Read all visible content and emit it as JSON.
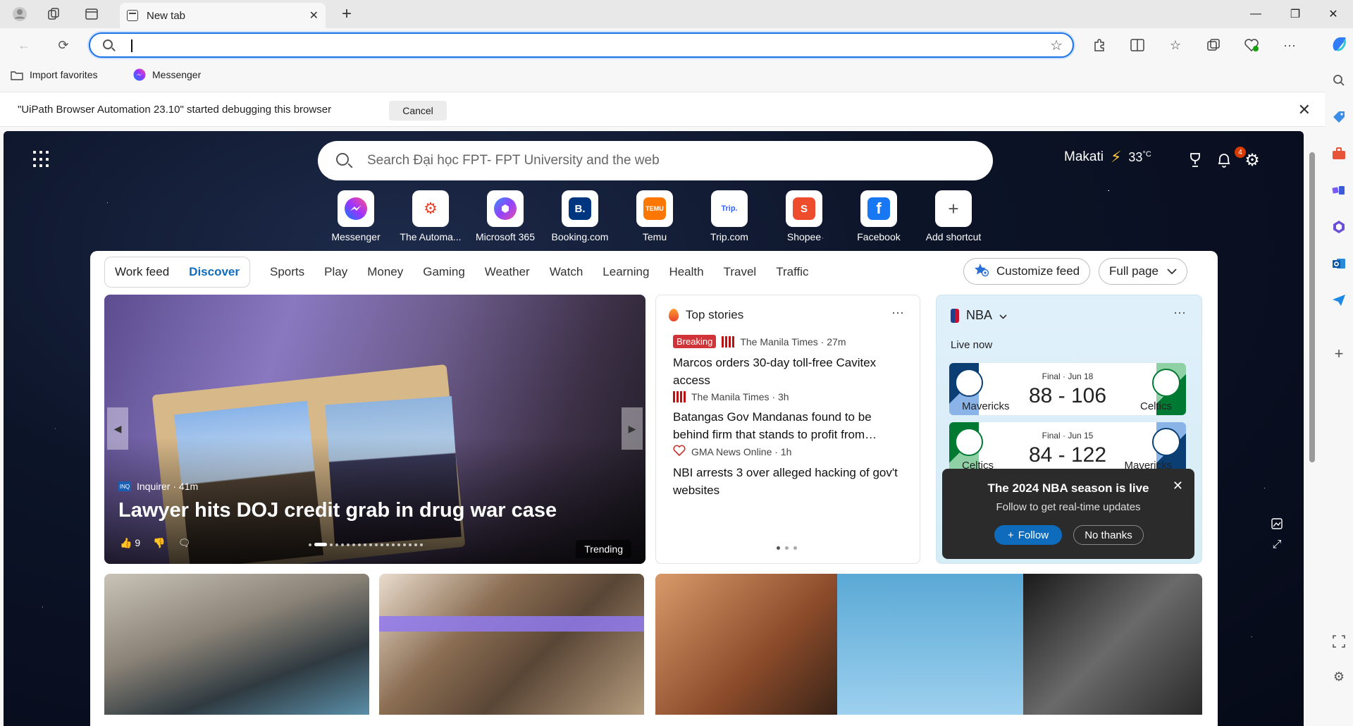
{
  "browser": {
    "tab_title": "New tab",
    "address_value": "",
    "favorites": [
      "Import favorites",
      "Messenger"
    ],
    "infobar_message": "\"UiPath Browser Automation 23.10\" started debugging this browser",
    "infobar_cancel": "Cancel"
  },
  "ntp": {
    "search_placeholder": "Search Đại học FPT- FPT University and the web",
    "city": "Makati",
    "temperature": "33",
    "temp_unit": "°C",
    "notifications": "4"
  },
  "shortcuts": [
    {
      "label": "Messenger",
      "icon": "messenger-icon",
      "color": "#8f44ff"
    },
    {
      "label": "The Automa...",
      "icon": "automation-icon",
      "color": "#e8432c"
    },
    {
      "label": "Microsoft 365",
      "icon": "m365-icon",
      "color": "#6a5acd"
    },
    {
      "label": "Booking.com",
      "icon": "booking-icon",
      "color": "#003580"
    },
    {
      "label": "Temu",
      "icon": "temu-icon",
      "color": "#fb7701"
    },
    {
      "label": "Trip.com",
      "icon": "trip-icon",
      "color": "#3264ff"
    },
    {
      "label": "Shopee",
      "icon": "shopee-icon",
      "color": "#ee4d2d"
    },
    {
      "label": "Facebook",
      "icon": "facebook-icon",
      "color": "#1877f2"
    },
    {
      "label": "Add shortcut",
      "icon": "plus-icon",
      "color": "#ffffff"
    }
  ],
  "feed": {
    "segments": [
      "Work feed",
      "Discover"
    ],
    "categories": [
      "Sports",
      "Play",
      "Money",
      "Gaming",
      "Weather",
      "Watch",
      "Learning",
      "Health",
      "Travel",
      "Traffic"
    ],
    "customize": "Customize feed",
    "layout": "Full page"
  },
  "hero": {
    "source": "Inquirer",
    "age": "41m",
    "headline": "Lawyer hits DOJ credit grab in drug war case",
    "likes": "9",
    "badge": "Trending"
  },
  "top_stories": {
    "title": "Top stories",
    "items": [
      {
        "breaking": "Breaking",
        "source": "The Manila Times",
        "age": "27m",
        "headline": "Marcos orders 30-day toll-free Cavitex access"
      },
      {
        "breaking": "",
        "source": "The Manila Times",
        "age": "3h",
        "headline": "Batangas Gov Mandanas found to be behind firm that stands to profit from…"
      },
      {
        "breaking": "",
        "source": "GMA News Online",
        "age": "1h",
        "headline": "NBI arrests 3 over alleged hacking of gov't websites"
      }
    ]
  },
  "nba": {
    "title": "NBA",
    "live_now": "Live now",
    "games": [
      {
        "status": "Final · Jun 18",
        "score": "88 - 106",
        "home": "Mavericks",
        "away": "Celtics"
      },
      {
        "status": "Final · Jun 15",
        "score": "84 - 122",
        "home": "Celtics",
        "away": "Mavericks"
      }
    ],
    "popup_title": "The 2024 NBA season is live",
    "popup_sub": "Follow to get real-time updates",
    "follow": "Follow",
    "no_thanks": "No thanks"
  }
}
